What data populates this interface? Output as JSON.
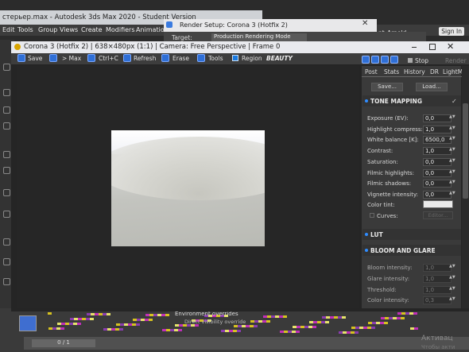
{
  "max_window": {
    "title": "стерьер.max - Autodesk 3ds Max 2020 - Student Version",
    "menu": [
      "Edit",
      "Tools",
      "Group",
      "Views",
      "Create",
      "Modifiers",
      "Animation"
    ],
    "menu_right_nt": "nt",
    "menu_right_arnold": "Arnold",
    "sign_in": "Sign In",
    "environment_overrides": "Environment overrides",
    "direct_visibility": "Direct visibility override",
    "frame_counter": "0 / 1",
    "watermark_line1": "Активац",
    "watermark_line2": "Чтобы акти"
  },
  "render_setup": {
    "title": "Render Setup: Corona 3 (Hotfix 2)",
    "target_label": "Target:",
    "target_value": "Production Rendering Mode"
  },
  "vfb": {
    "title": "Corona 3 (Hotfix 2) | 638×480px (1:1) | Camera: Free Perspective | Frame 0",
    "toolbar": {
      "save": "Save",
      "max": "> Max",
      "ctrl_c": "Ctrl+C",
      "refresh": "Refresh",
      "erase": "Erase",
      "tools": "Tools",
      "region": "Region",
      "beauty": "BEAUTY"
    },
    "right_toolbar": {
      "stop": "Stop",
      "render": "Render"
    }
  },
  "panel": {
    "tabs": [
      "Post",
      "Stats",
      "History",
      "DR",
      "LightMix"
    ],
    "save_button": "Save...",
    "load_button": "Load...",
    "tone_mapping": {
      "heading": "TONE MAPPING",
      "rows": [
        {
          "label": "Exposure (EV):",
          "value": "0,0"
        },
        {
          "label": "Highlight compress:",
          "value": "1,0"
        },
        {
          "label": "White balance [K]:",
          "value": "6500,0"
        },
        {
          "label": "Contrast:",
          "value": "1,0"
        },
        {
          "label": "Saturation:",
          "value": "0,0"
        },
        {
          "label": "Filmic highlights:",
          "value": "0,0"
        },
        {
          "label": "Filmic shadows:",
          "value": "0,0"
        },
        {
          "label": "Vignette intensity:",
          "value": "0,0"
        }
      ],
      "color_tint_label": "Color tint:",
      "color_tint": "#eaeaea",
      "curves_label": "Curves:",
      "curves_editor": "Editor..."
    },
    "lut": {
      "heading": "LUT"
    },
    "bloom_glare": {
      "heading": "BLOOM AND GLARE",
      "rows": [
        {
          "label": "Bloom intensity:",
          "value": "1,0"
        },
        {
          "label": "Glare intensity:",
          "value": "1,0"
        },
        {
          "label": "Threshold:",
          "value": "1,0"
        },
        {
          "label": "Color intensity:",
          "value": "0,3"
        }
      ]
    }
  },
  "colors": {
    "accent_blue": "#2f6fd6",
    "panel_bg": "#3a3a3a",
    "viewport_bg": "#262626",
    "title_bar": "#e9eaee"
  }
}
